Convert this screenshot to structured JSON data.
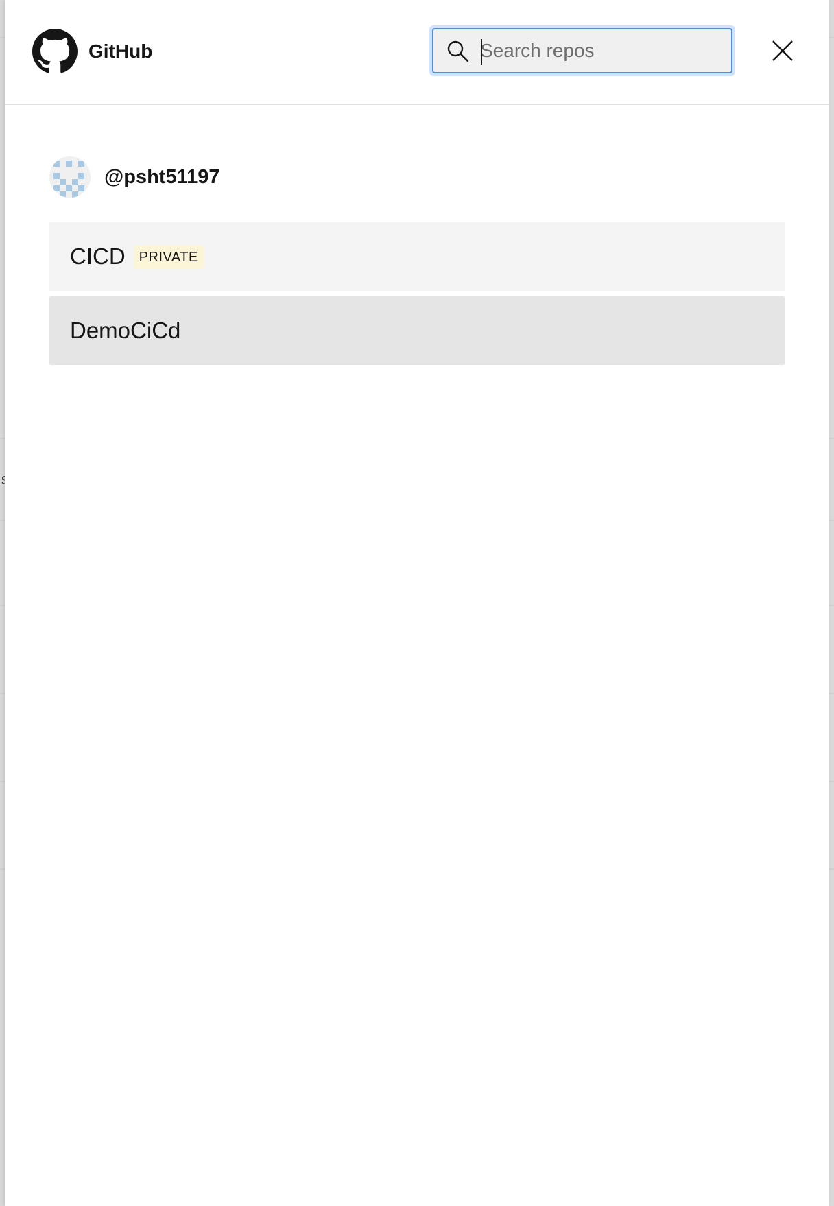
{
  "header": {
    "brand_name": "GitHub",
    "search": {
      "placeholder": "Search repos",
      "value": ""
    },
    "close_label": "Close"
  },
  "account": {
    "username": "@psht51197"
  },
  "repos": [
    {
      "name": "CICD",
      "badge": "PRIVATE"
    },
    {
      "name": "DemoCiCd",
      "badge": ""
    }
  ],
  "colors": {
    "focus_ring": "#4f8fd8",
    "private_badge_bg": "#fcf4d6",
    "row_bg": "#f4f4f4",
    "row_hover_bg": "#e5e5e5"
  },
  "icons": {
    "brand": "github-icon",
    "search": "search-icon",
    "close": "close-icon"
  }
}
